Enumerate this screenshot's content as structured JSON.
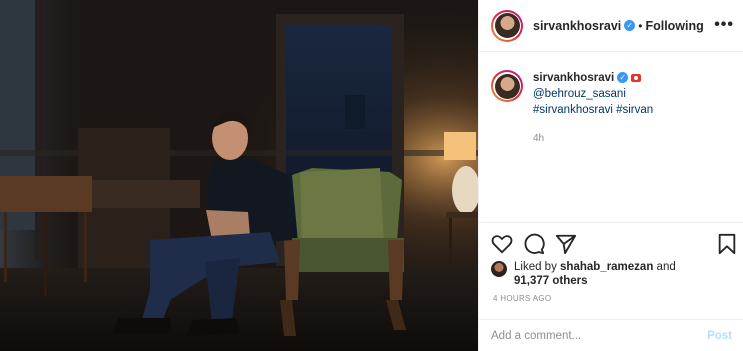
{
  "post": {
    "username": "sirvankhosravi",
    "follow_separator": "•",
    "follow_status": "Following",
    "more_label": "•••"
  },
  "caption": {
    "username": "sirvankhosravi",
    "mention": "@behrouz_sasani",
    "hashtag_1": "#sirvankhosravi",
    "hashtag_2": "#sirvan",
    "time": "4h"
  },
  "likes": {
    "prefix": "Liked by ",
    "user": "shahab_ramezan",
    "connector": " and",
    "count": "91,377 others"
  },
  "timestamp": "4 HOURS AGO",
  "comment": {
    "placeholder": "Add a comment...",
    "post_label": "Post"
  },
  "icons": {
    "verified": "verified-badge-icon",
    "camera": "camera-emoji-icon",
    "like": "heart-icon",
    "comment": "comment-bubble-icon",
    "share": "paper-plane-icon",
    "save": "bookmark-icon"
  },
  "colors": {
    "verified": "#3897f0",
    "link": "#003569",
    "muted": "#8e8e8e",
    "post_disabled": "#b2dffc"
  }
}
